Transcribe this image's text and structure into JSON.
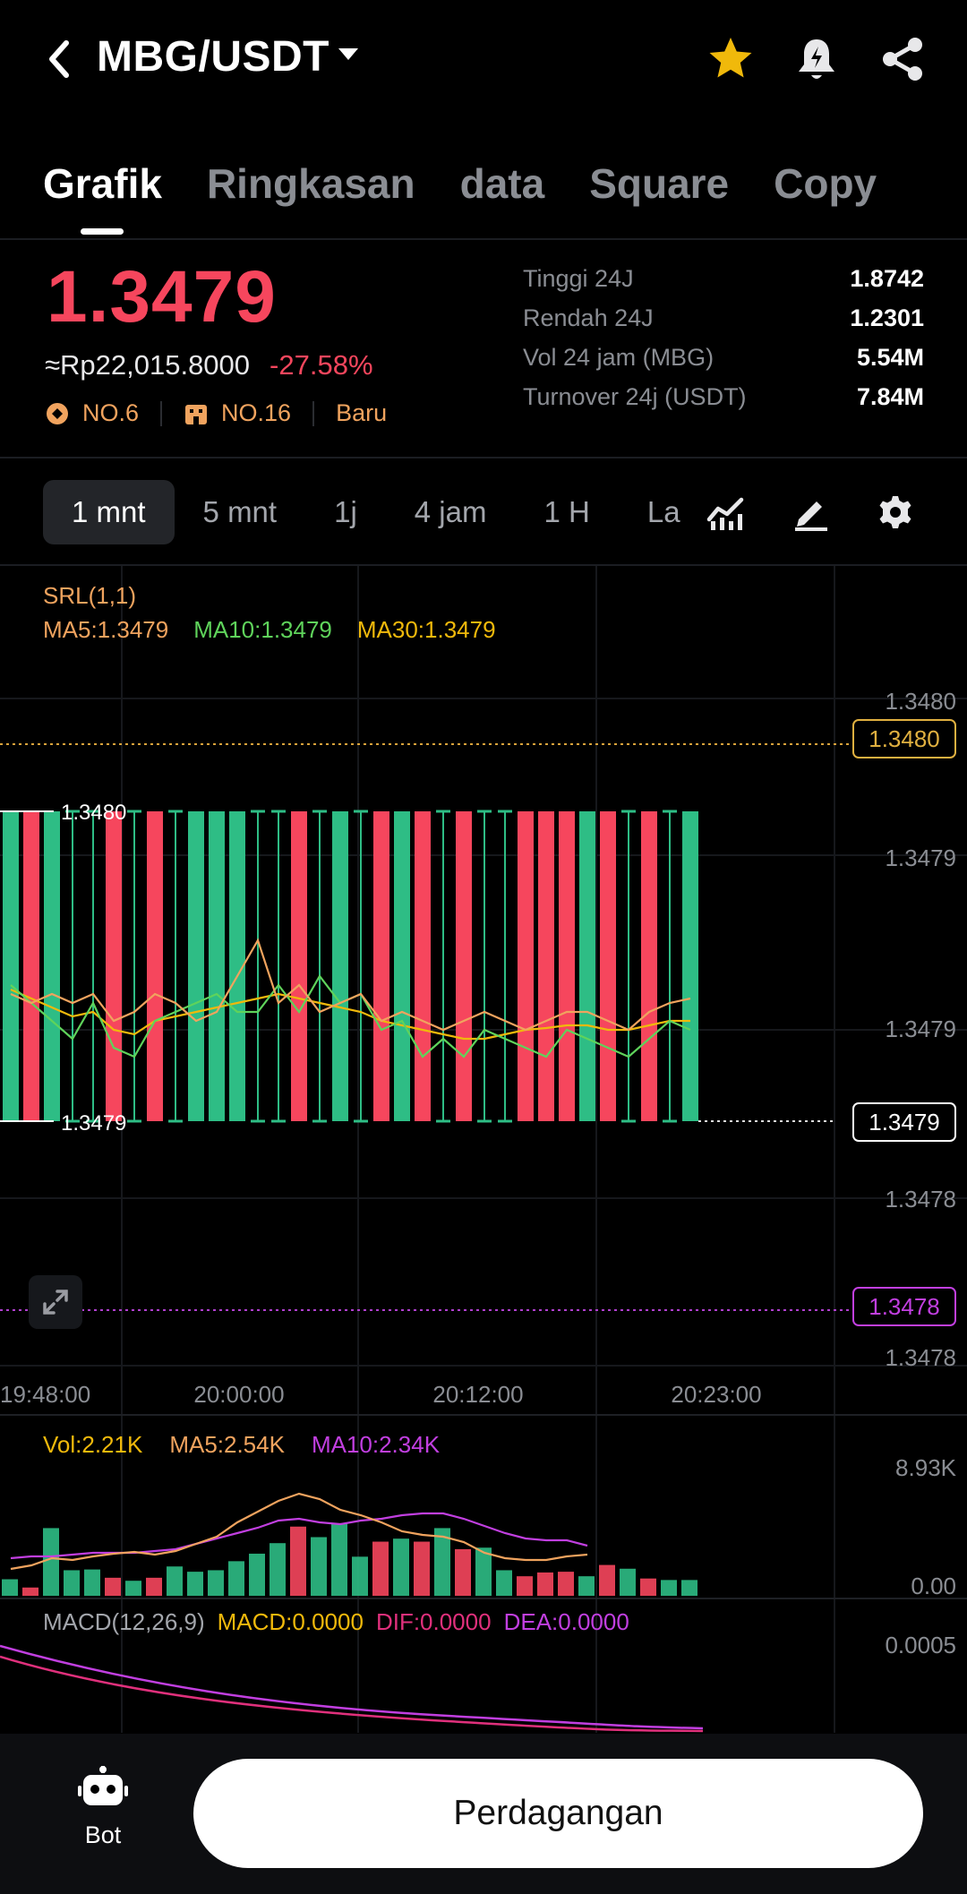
{
  "header": {
    "pair": "MBG/USDT"
  },
  "tabs": [
    "Grafik",
    "Ringkasan",
    "data",
    "Square",
    "Copy"
  ],
  "ticker": {
    "price": "1.3479",
    "fiat_price": "≈Rp22,015.8000",
    "change": "-27.58%",
    "rank1": "NO.6",
    "rank2": "NO.16",
    "tag": "Baru",
    "stats": [
      {
        "label": "Tinggi 24J",
        "value": "1.8742"
      },
      {
        "label": "Rendah 24J",
        "value": "1.2301"
      },
      {
        "label": "Vol 24 jam (MBG)",
        "value": "5.54M"
      },
      {
        "label": "Turnover 24j (USDT)",
        "value": "7.84M"
      }
    ]
  },
  "intervals": [
    "1 mnt",
    "5 mnt",
    "1j",
    "4 jam",
    "1 H",
    "La"
  ],
  "indicators": {
    "srl": "SRL(1,1)",
    "ma5": "MA5:1.3479",
    "ma10": "MA10:1.3479",
    "ma30": "MA30:1.3479",
    "vol": "Vol:2.21K",
    "vol_ma5": "MA5:2.54K",
    "vol_ma10": "MA10:2.34K",
    "macd_params": "MACD(12,26,9)",
    "macd": "MACD:0.0000",
    "dif": "DIF:0.0000",
    "dea": "DEA:0.0000"
  },
  "colors": {
    "up": "#2ebd85",
    "down": "#f6465d",
    "ma5": "#f0a35e",
    "ma10": "#5fd35b",
    "ma30": "#f0b90b",
    "purple": "#c13fe0",
    "magenta": "#e0307c",
    "star": "#f0b90b"
  },
  "chart_data": [
    {
      "type": "candlestick",
      "x_labels": [
        "19:48:00",
        "20:00:00",
        "20:12:00",
        "20:23:00"
      ],
      "y_labels": [
        "1.3480",
        "1.3479",
        "1.3479",
        "1.3478",
        "1.3478"
      ],
      "high_label": "1.3480",
      "low_label": "1.3479",
      "last_price_tag": "1.3479",
      "upper_tag": "1.3480",
      "lower_tag": "1.3478",
      "candles": [
        {
          "d": "up",
          "body": "full"
        },
        {
          "d": "down",
          "body": "full"
        },
        {
          "d": "up",
          "body": "full"
        },
        {
          "d": "up",
          "body": "doji"
        },
        {
          "d": "up",
          "body": "doji"
        },
        {
          "d": "down",
          "body": "full"
        },
        {
          "d": "up",
          "body": "doji"
        },
        {
          "d": "down",
          "body": "full"
        },
        {
          "d": "up",
          "body": "doji"
        },
        {
          "d": "up",
          "body": "full"
        },
        {
          "d": "up",
          "body": "full"
        },
        {
          "d": "up",
          "body": "full"
        },
        {
          "d": "up",
          "body": "doji"
        },
        {
          "d": "up",
          "body": "doji"
        },
        {
          "d": "down",
          "body": "full"
        },
        {
          "d": "up",
          "body": "doji"
        },
        {
          "d": "up",
          "body": "full"
        },
        {
          "d": "up",
          "body": "doji"
        },
        {
          "d": "down",
          "body": "full"
        },
        {
          "d": "up",
          "body": "full"
        },
        {
          "d": "down",
          "body": "full"
        },
        {
          "d": "up",
          "body": "doji"
        },
        {
          "d": "down",
          "body": "full"
        },
        {
          "d": "up",
          "body": "doji"
        },
        {
          "d": "up",
          "body": "doji"
        },
        {
          "d": "down",
          "body": "full"
        },
        {
          "d": "down",
          "body": "full"
        },
        {
          "d": "down",
          "body": "full"
        },
        {
          "d": "up",
          "body": "full"
        },
        {
          "d": "down",
          "body": "full"
        },
        {
          "d": "up",
          "body": "doji"
        },
        {
          "d": "down",
          "body": "full"
        },
        {
          "d": "up",
          "body": "doji"
        },
        {
          "d": "up",
          "body": "full"
        }
      ]
    },
    {
      "type": "bar",
      "y_labels": [
        "8.93K",
        "0.00"
      ],
      "values": [
        1.1,
        0.55,
        4.5,
        1.7,
        1.75,
        1.2,
        1.0,
        1.2,
        1.95,
        1.6,
        1.7,
        2.3,
        2.8,
        3.5,
        4.6,
        3.9,
        4.8,
        2.6,
        3.6,
        3.8,
        3.6,
        4.5,
        3.1,
        3.2,
        1.7,
        1.3,
        1.55,
        1.6,
        1.3,
        2.05,
        1.8,
        1.15,
        1.05,
        1.05
      ]
    },
    {
      "type": "line",
      "y_labels": [
        "0.0005"
      ]
    }
  ],
  "bottom": {
    "bot_label": "Bot",
    "trade_label": "Perdagangan"
  }
}
